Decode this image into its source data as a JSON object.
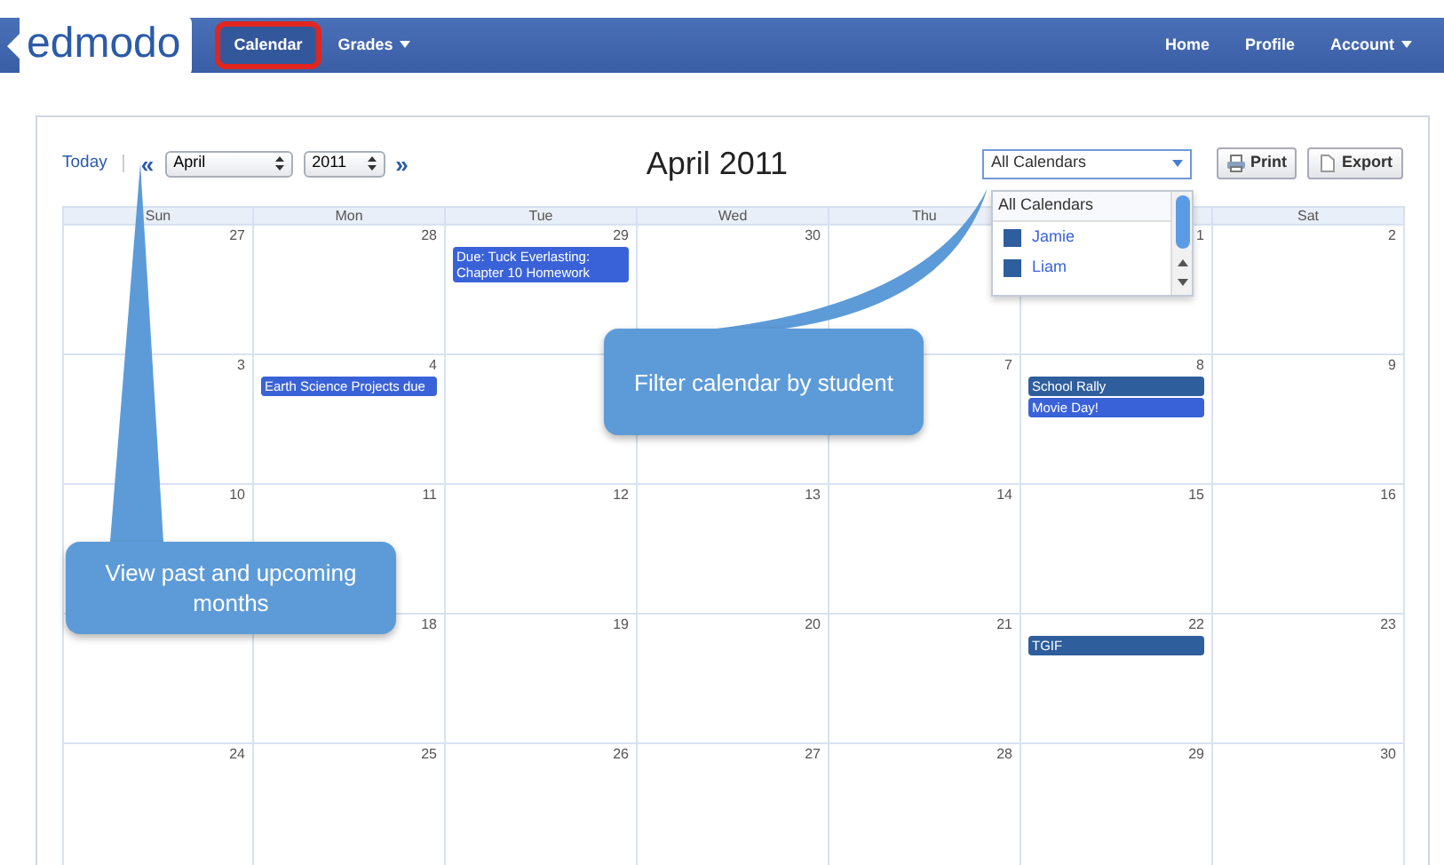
{
  "navbar": {
    "logo": "edmodo",
    "left_items": [
      {
        "label": "Calendar",
        "selected": true,
        "highlighted": true,
        "dropdown": false
      },
      {
        "label": "Grades",
        "selected": false,
        "highlighted": false,
        "dropdown": true
      }
    ],
    "right_items": [
      {
        "label": "Home",
        "dropdown": false
      },
      {
        "label": "Profile",
        "dropdown": false
      },
      {
        "label": "Account",
        "dropdown": true
      }
    ]
  },
  "toolbar": {
    "today": "Today",
    "prev": "«",
    "month": "April",
    "year": "2011",
    "next": "»",
    "title": "April 2011",
    "filter": {
      "value": "All Calendars",
      "expanded": true,
      "options": [
        {
          "label": "All Calendars",
          "kind": "all",
          "selected": true
        },
        {
          "label": "Jamie",
          "kind": "student",
          "selected": false,
          "color": "#2e5e9c"
        },
        {
          "label": "Liam",
          "kind": "student",
          "selected": false,
          "color": "#2e5e9c"
        }
      ]
    },
    "buttons": [
      {
        "label": "Print",
        "kind": "print"
      },
      {
        "label": "Export",
        "kind": "export"
      }
    ]
  },
  "calendar": {
    "weekdays": [
      {
        "label": "Sun"
      },
      {
        "label": "Mon"
      },
      {
        "label": "Tue"
      },
      {
        "label": "Wed"
      },
      {
        "label": "Thu"
      },
      {
        "covered": true
      },
      {
        "label": "Sat"
      }
    ],
    "weeks": [
      {
        "days": [
          {
            "date": "27"
          },
          {
            "date": "28"
          },
          {
            "date": "29",
            "events": [
              {
                "title": "Due: Tuck Everlasting: Chapter 10 Homework",
                "color": "#3a62d8"
              }
            ]
          },
          {
            "date": "30"
          },
          {
            "covered": true
          },
          {
            "date": "1"
          },
          {
            "date": "2"
          }
        ]
      },
      {
        "days": [
          {
            "date": "3"
          },
          {
            "date": "4",
            "events": [
              {
                "title": "Earth Science Projects due",
                "color": "#3a62d8"
              }
            ]
          },
          {
            "covered": true
          },
          {
            "covered": true
          },
          {
            "date": "7"
          },
          {
            "date": "8",
            "events": [
              {
                "title": "School Rally",
                "color": "#2e5e9c"
              },
              {
                "title": "Movie Day!",
                "color": "#3a62d8"
              }
            ]
          },
          {
            "date": "9"
          }
        ]
      },
      {
        "days": [
          {
            "date": "10"
          },
          {
            "date": "11"
          },
          {
            "date": "12"
          },
          {
            "date": "13"
          },
          {
            "date": "14"
          },
          {
            "date": "15"
          },
          {
            "date": "16"
          }
        ]
      },
      {
        "days": [
          {
            "covered": true
          },
          {
            "date": "18"
          },
          {
            "date": "19"
          },
          {
            "date": "20"
          },
          {
            "date": "21"
          },
          {
            "date": "22",
            "events": [
              {
                "title": "TGIF",
                "color": "#2e5e9c"
              }
            ]
          },
          {
            "date": "23"
          }
        ]
      },
      {
        "days": [
          {
            "date": "24"
          },
          {
            "date": "25"
          },
          {
            "date": "26"
          },
          {
            "date": "27"
          },
          {
            "date": "28"
          },
          {
            "date": "29"
          },
          {
            "date": "30"
          }
        ]
      }
    ]
  },
  "callouts": [
    {
      "text": "Filter calendar by student"
    },
    {
      "text": "View past and upcoming months"
    }
  ]
}
